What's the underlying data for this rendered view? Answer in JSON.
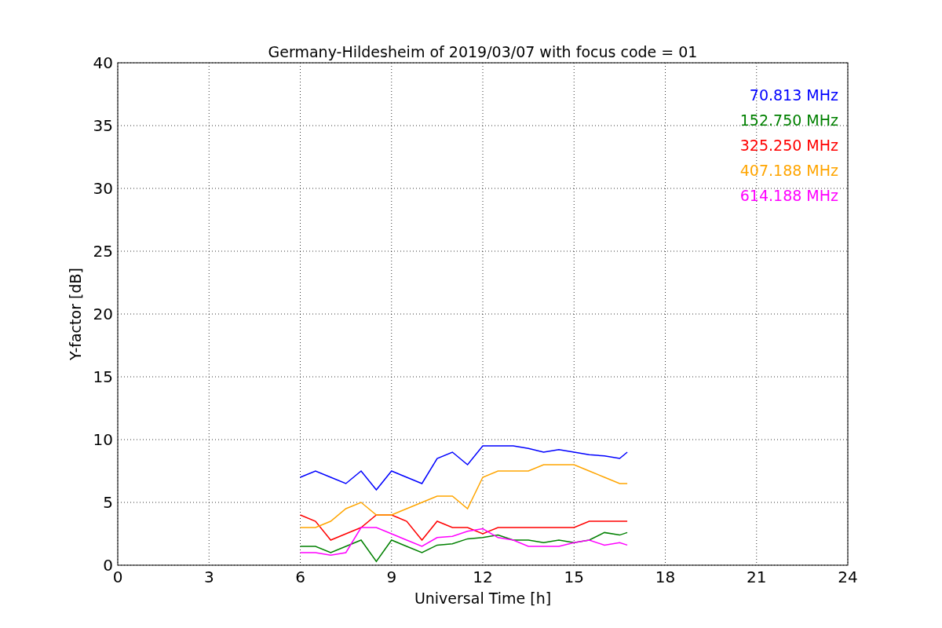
{
  "chart_data": {
    "type": "line",
    "grid": true,
    "title": "Germany-Hildesheim of 2019/03/07 with focus code = 01",
    "xlabel": "Universal Time [h]",
    "ylabel": "Y-factor [dB]",
    "x": [
      6,
      6.5,
      7,
      7.5,
      8,
      8.5,
      9,
      9.5,
      10,
      10.5,
      11,
      11.5,
      12,
      12.5,
      13,
      13.5,
      14,
      14.5,
      15,
      15.5,
      16,
      16.5,
      16.75
    ],
    "xlim": [
      0,
      24
    ],
    "ylim": [
      0,
      40
    ],
    "xticks": [
      0,
      3,
      6,
      9,
      12,
      15,
      18,
      21,
      24
    ],
    "yticks": [
      0,
      5,
      10,
      15,
      20,
      25,
      30,
      35,
      40
    ],
    "series": [
      {
        "name": "70.813 MHz",
        "color": "#0000ff",
        "values": [
          7,
          7.5,
          7,
          6.5,
          7.5,
          6,
          7.5,
          7,
          6.5,
          8.5,
          9,
          8,
          9.5,
          9.5,
          9.5,
          9.3,
          9,
          9.2,
          9,
          8.8,
          8.7,
          8.5,
          9
        ]
      },
      {
        "name": "152.750 MHz",
        "color": "#008000",
        "values": [
          1.5,
          1.5,
          1,
          1.5,
          2,
          0.3,
          2,
          1.5,
          1,
          1.6,
          1.7,
          2.1,
          2.2,
          2.4,
          2,
          2,
          1.8,
          2,
          1.8,
          2,
          2.6,
          2.4,
          2.6
        ]
      },
      {
        "name": "325.250 MHz",
        "color": "#ff0000",
        "values": [
          4,
          3.5,
          2,
          2.5,
          3,
          4,
          4,
          3.5,
          2,
          3.5,
          3,
          3,
          2.5,
          3,
          3,
          3,
          3,
          3,
          3,
          3.5,
          3.5,
          3.5,
          3.5
        ]
      },
      {
        "name": "407.188 MHz",
        "color": "#ffa500",
        "values": [
          3,
          3,
          3.5,
          4.5,
          5,
          4,
          4,
          4.5,
          5,
          5.5,
          5.5,
          4.5,
          7,
          7.5,
          7.5,
          7.5,
          8,
          8,
          8,
          7.5,
          7,
          6.5,
          6.5
        ]
      },
      {
        "name": "614.188 MHz",
        "color": "#ff00ff",
        "values": [
          1,
          1,
          0.8,
          1,
          3,
          3,
          2.5,
          2,
          1.5,
          2.2,
          2.3,
          2.7,
          2.9,
          2.2,
          2,
          1.5,
          1.5,
          1.5,
          1.8,
          2,
          1.6,
          1.8,
          1.6
        ]
      }
    ]
  }
}
